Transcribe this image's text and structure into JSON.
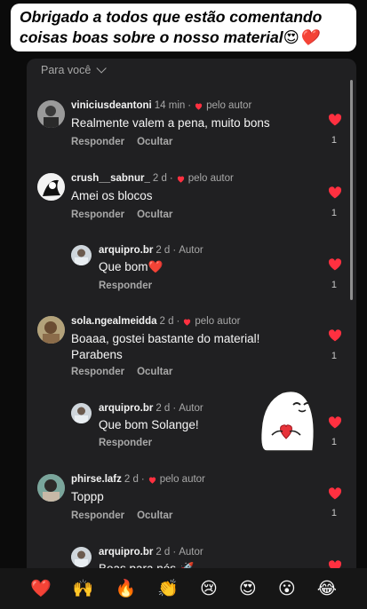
{
  "banner": {
    "line1": "Obrigado a todos que estão comentando",
    "line2": "coisas boas sobre o nosso material😍❤️"
  },
  "panel": {
    "header": "Para você"
  },
  "comments": [
    {
      "username": "viniciusdeantoni",
      "time": "14 min",
      "badge": "pelo autor",
      "text": "Realmente valem a pena, muito bons",
      "reply_label": "Responder",
      "hide_label": "Ocultar",
      "likes": "1"
    },
    {
      "username": "crush__sabnur_",
      "time": "2 d",
      "badge": "pelo autor",
      "text": "Amei os blocos",
      "reply_label": "Responder",
      "hide_label": "Ocultar",
      "likes": "1"
    },
    {
      "username": "arquipro.br",
      "time": "2 d",
      "badge": "Autor",
      "text": "Que bom❤️",
      "reply_label": "Responder",
      "likes": "1"
    },
    {
      "username": "sola.ngealmeidda",
      "time": "2 d",
      "badge": "pelo autor",
      "text_line1": "Boaaa, gostei bastante do material!",
      "text_line2": "Parabens",
      "reply_label": "Responder",
      "hide_label": "Ocultar",
      "likes": "1"
    },
    {
      "username": "arquipro.br",
      "time": "2 d",
      "badge": "Autor",
      "text": "Que bom Solange!",
      "reply_label": "Responder",
      "likes": "1"
    },
    {
      "username": "phirse.lafz",
      "time": "2 d",
      "badge": "pelo autor",
      "text": "Toppp",
      "reply_label": "Responder",
      "hide_label": "Ocultar",
      "likes": "1"
    },
    {
      "username": "arquipro.br",
      "time": "2 d",
      "badge": "Autor",
      "text": "Boas para nós 🚀"
    }
  ],
  "reactions": [
    "❤️",
    "🙌",
    "🔥",
    "👏",
    "😢",
    "😍",
    "😮",
    "😂"
  ],
  "colors": {
    "heart": "#ff3040",
    "panel": "#202022",
    "background": "#0b0b0b"
  }
}
